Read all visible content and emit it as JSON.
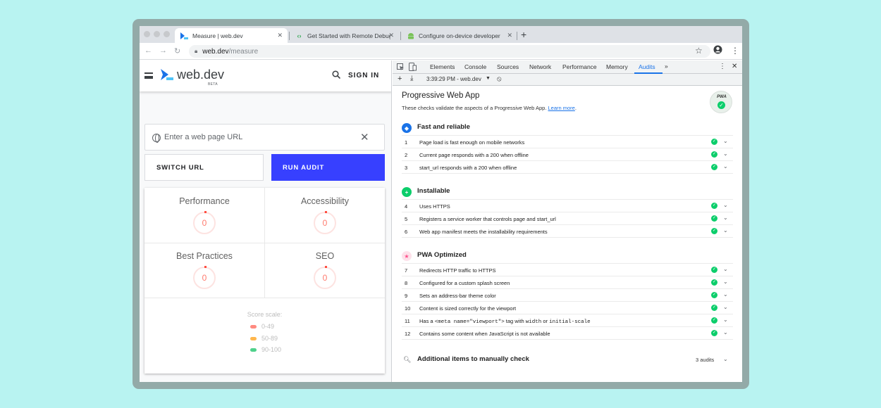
{
  "browser": {
    "tabs": [
      {
        "title": "Measure  |  web.dev",
        "icon": "webdev-favicon",
        "active": true
      },
      {
        "title": "Get Started with Remote Debugging",
        "icon": "chrome-dev-favicon",
        "active": false
      },
      {
        "title": "Configure on-device developer options",
        "icon": "android-favicon",
        "active": false
      }
    ],
    "new_tab_icon": "plus-icon",
    "url_domain": "web.dev",
    "url_path": "/measure"
  },
  "site": {
    "brand": "web.dev",
    "beta": "BETA",
    "signin": "SIGN IN",
    "url_placeholder": "Enter a web page URL",
    "switch_label": "SWITCH URL",
    "run_label": "RUN AUDIT",
    "accent": "#3740ff",
    "scores": [
      {
        "label": "Performance",
        "value": "0"
      },
      {
        "label": "Accessibility",
        "value": "0"
      },
      {
        "label": "Best Practices",
        "value": "0"
      },
      {
        "label": "SEO",
        "value": "0"
      }
    ],
    "scale_title": "Score scale:",
    "scale": [
      {
        "range": "0-49",
        "color": "#ff8a80"
      },
      {
        "range": "50-89",
        "color": "#ffb74d"
      },
      {
        "range": "90-100",
        "color": "#4fd18b"
      }
    ]
  },
  "devtools": {
    "tabs": [
      "Elements",
      "Console",
      "Sources",
      "Network",
      "Performance",
      "Memory",
      "Audits"
    ],
    "active_tab": "Audits",
    "more": "»",
    "report_selector": "3:39:29 PM - web.dev",
    "category_title": "Progressive Web App",
    "category_desc": "These checks validate the aspects of a Progressive Web App.",
    "learn_more": "Learn more",
    "badge": "PWA",
    "groups": [
      {
        "title": "Fast and reliable",
        "color": "#1a73e8",
        "icon": "shield-icon"
      },
      {
        "title": "Installable",
        "color": "#0cce6b",
        "icon": "plus-icon"
      },
      {
        "title": "PWA Optimized",
        "color": "#ff4e8a",
        "icon": "star-icon"
      }
    ],
    "audits": [
      {
        "n": "1",
        "text": "Page load is fast enough on mobile networks"
      },
      {
        "n": "2",
        "text": "Current page responds with a 200 when offline"
      },
      {
        "n": "3",
        "text": "start_url responds with a 200 when offline"
      },
      {
        "n": "4",
        "text": "Uses HTTPS"
      },
      {
        "n": "5",
        "text": "Registers a service worker that controls page and start_url"
      },
      {
        "n": "6",
        "text": "Web app manifest meets the installability requirements"
      },
      {
        "n": "7",
        "text": "Redirects HTTP traffic to HTTPS"
      },
      {
        "n": "8",
        "text": "Configured for a custom splash screen"
      },
      {
        "n": "9",
        "text": "Sets an address-bar theme color"
      },
      {
        "n": "10",
        "text": "Content is sized correctly for the viewport"
      },
      {
        "n": "11",
        "text_pre": "Has a ",
        "code1": "<meta name=\"viewport\">",
        "text_mid": " tag with ",
        "code2": "width",
        "text_or": " or ",
        "code3": "initial-scale"
      },
      {
        "n": "12",
        "text": "Contains some content when JavaScript is not available"
      }
    ],
    "manual_title": "Additional items to manually check",
    "manual_count": "3 audits"
  }
}
